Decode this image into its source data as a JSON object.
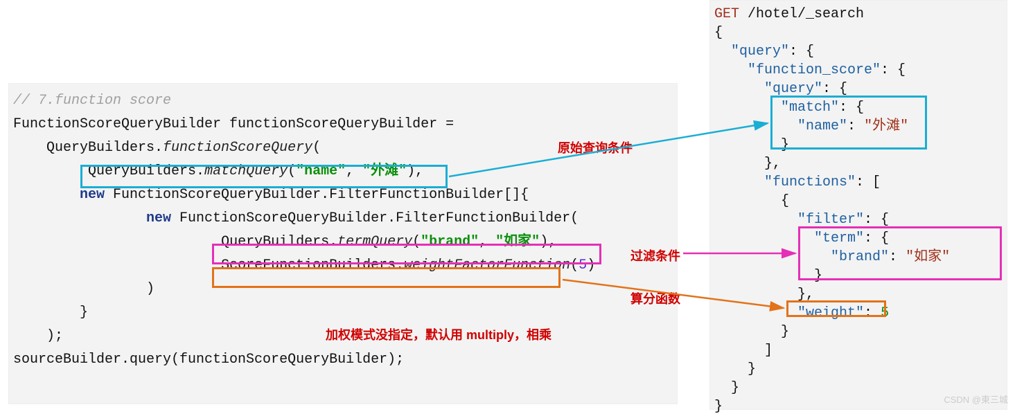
{
  "java": {
    "comment": "// 7.function score",
    "line1_a": "FunctionScoreQueryBuilder functionScoreQueryBuilder =",
    "line2_pre": "    QueryBuilders.",
    "line2_m": "functionScoreQuery",
    "line2_post": "(",
    "match_pre": "QueryBuilders.",
    "match_m": "matchQuery",
    "match_args_open": "(",
    "match_arg1": "\"name\"",
    "match_sep": ", ",
    "match_arg2": "\"外滩\"",
    "match_close": "),",
    "line4_pre": "        ",
    "line4_kw": "new",
    "line4_post": " FunctionScoreQueryBuilder.FilterFunctionBuilder[]{",
    "line5_pre": "                ",
    "line5_kw": "new",
    "line5_post": " FunctionScoreQueryBuilder.FilterFunctionBuilder(",
    "term_pre": "QueryBuilders.",
    "term_m": "termQuery",
    "term_arg1": "\"brand\"",
    "term_sep": ", ",
    "term_arg2": "\"如家\"",
    "term_close": "),",
    "score_pre": "ScoreFunctionBuilders.",
    "score_m": "weightFactorFunction",
    "score_open": "(",
    "score_num": "5",
    "score_close": ")",
    "line8": "                )",
    "line9": "        }",
    "line10": "    );",
    "line11": "sourceBuilder.query(functionScoreQueryBuilder);"
  },
  "json": {
    "l0_get": "GET",
    "l0_path": " /hotel/_search",
    "l1": "{",
    "l2a": "  ",
    "l2k": "\"query\"",
    "l2b": ": {",
    "l3a": "    ",
    "l3k": "\"function_score\"",
    "l3b": ": {",
    "l4a": "      ",
    "l4k": "\"query\"",
    "l4b": ": {",
    "l5a": "        ",
    "l5k": "\"match\"",
    "l5b": ": {",
    "l6a": "          ",
    "l6k": "\"name\"",
    "l6b": ": ",
    "l6v": "\"外滩\"",
    "l7": "        }",
    "l8": "      },",
    "l9a": "      ",
    "l9k": "\"functions\"",
    "l9b": ": [",
    "l10": "        {",
    "l11a": "          ",
    "l11k": "\"filter\"",
    "l11b": ": {",
    "l12a": "            ",
    "l12k": "\"term\"",
    "l12b": ": {",
    "l13a": "              ",
    "l13k": "\"brand\"",
    "l13b": ": ",
    "l13v": "\"如家\"",
    "l14": "            }",
    "l15": "          },",
    "l16a": "          ",
    "l16k": "\"weight\"",
    "l16b": ": ",
    "l16v": "5",
    "l17": "        }",
    "l18": "      ]",
    "l19": "    }",
    "l20": "  }",
    "l21": "}"
  },
  "labels": {
    "orig": "原始查询条件",
    "filter": "过滤条件",
    "score": "算分函数",
    "mode": "加权模式没指定，默认用 multiply，相乘"
  },
  "watermark": "CSDN @東三城"
}
